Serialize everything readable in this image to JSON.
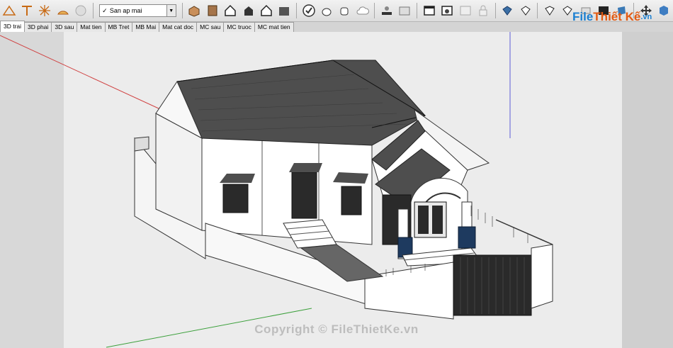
{
  "toolbar": {
    "layer_dropdown": {
      "checked": true,
      "value": "San ap mai"
    }
  },
  "tabs": [
    {
      "label": "3D trai",
      "active": true
    },
    {
      "label": "3D phai"
    },
    {
      "label": "3D sau"
    },
    {
      "label": "Mat tien"
    },
    {
      "label": "MB Tret"
    },
    {
      "label": "MB Mai"
    },
    {
      "label": "Mat cat doc"
    },
    {
      "label": "MC sau"
    },
    {
      "label": "MC truoc"
    },
    {
      "label": "MC mat tien"
    }
  ],
  "logo": {
    "part1": "File",
    "part2": "Thiết Kế",
    "part3": ".vn"
  },
  "watermark": "Copyright © FileThietKe.vn",
  "colors": {
    "roof": "#4e4e4e",
    "wall": "#ffffff",
    "column_base": "#1e3a5f",
    "axis_red": "#d04040",
    "axis_green": "#3ca03c",
    "axis_blue": "#5b5bd6"
  }
}
